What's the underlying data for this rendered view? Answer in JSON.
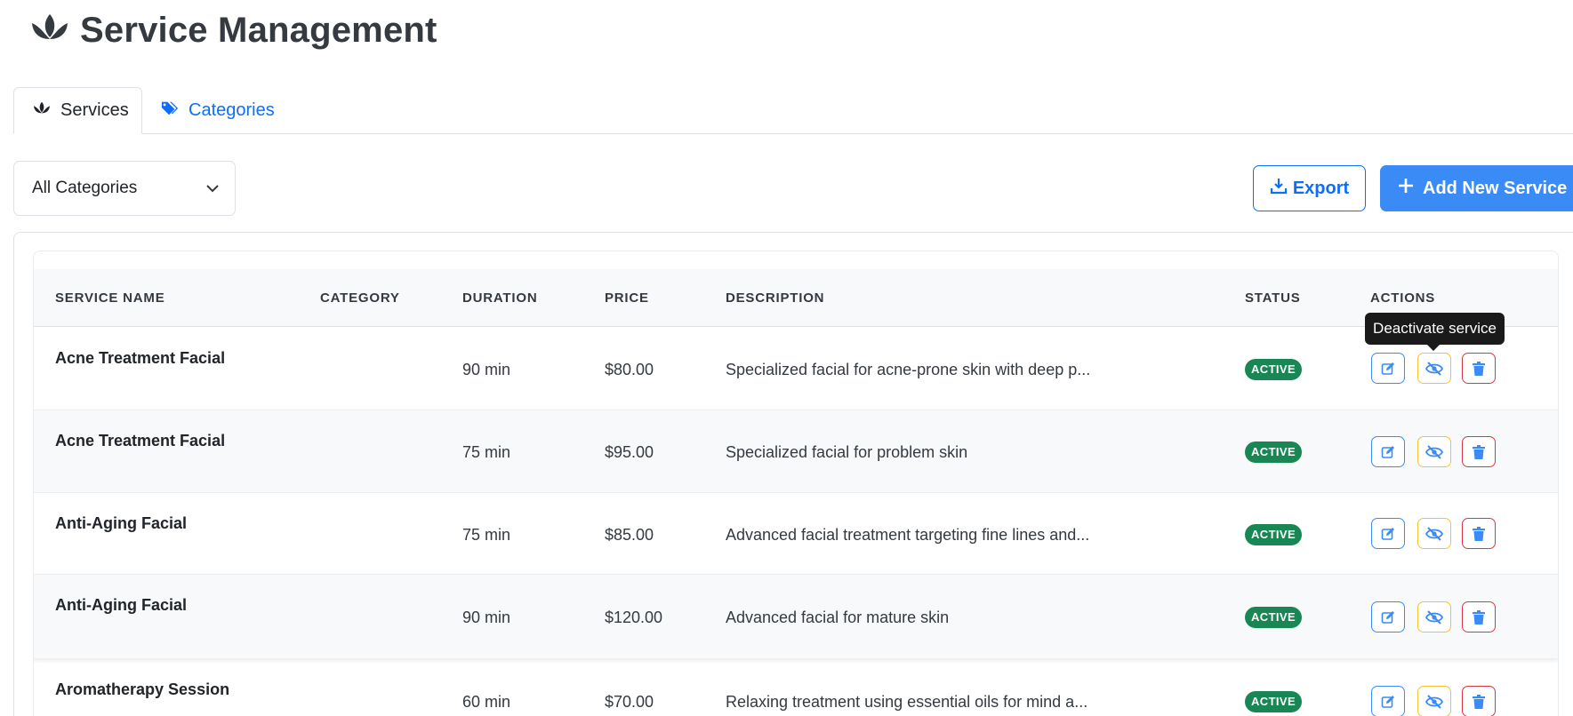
{
  "header": {
    "title": "Service Management",
    "icon": "lotus-icon"
  },
  "tabs": [
    {
      "label": "Services",
      "icon": "lotus-icon",
      "active": true
    },
    {
      "label": "Categories",
      "icon": "tags-icon",
      "active": false
    }
  ],
  "filter": {
    "selected": "All Categories"
  },
  "toolbar": {
    "export_label": "Export",
    "add_label": "Add New Service"
  },
  "table": {
    "columns": [
      "SERVICE NAME",
      "CATEGORY",
      "DURATION",
      "PRICE",
      "DESCRIPTION",
      "STATUS",
      "ACTIONS"
    ],
    "rows": [
      {
        "name": "Acne Treatment Facial",
        "category": "",
        "duration": "90 min",
        "price": "$80.00",
        "description": "Specialized facial for acne-prone skin with deep p...",
        "status": "ACTIVE"
      },
      {
        "name": "Acne Treatment Facial",
        "category": "",
        "duration": "75 min",
        "price": "$95.00",
        "description": "Specialized facial for problem skin",
        "status": "ACTIVE"
      },
      {
        "name": "Anti-Aging Facial",
        "category": "",
        "duration": "75 min",
        "price": "$85.00",
        "description": "Advanced facial treatment targeting fine lines and...",
        "status": "ACTIVE"
      },
      {
        "name": "Anti-Aging Facial",
        "category": "",
        "duration": "90 min",
        "price": "$120.00",
        "description": "Advanced facial for mature skin",
        "status": "ACTIVE"
      },
      {
        "name": "Aromatherapy Session",
        "category": "",
        "duration": "60 min",
        "price": "$70.00",
        "description": "Relaxing treatment using essential oils for mind a...",
        "status": "ACTIVE"
      }
    ]
  },
  "tooltip": {
    "text": "Deactivate service"
  },
  "colors": {
    "primary": "#0d6efd",
    "success": "#198754",
    "warning": "#f5c330",
    "danger": "#dc3545"
  }
}
